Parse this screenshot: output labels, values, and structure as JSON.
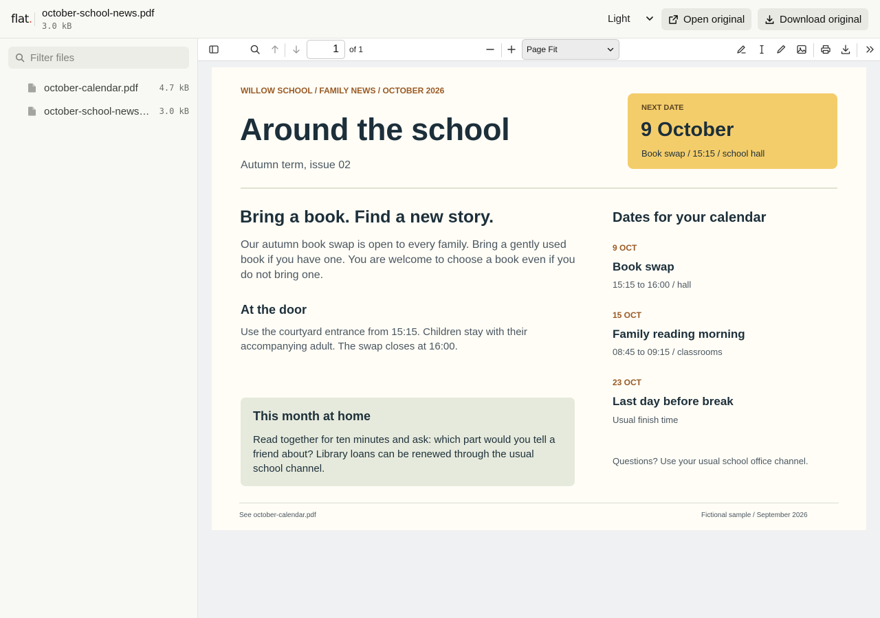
{
  "app": {
    "brand": "flat",
    "brand_dot": "."
  },
  "document": {
    "name": "october-school-news.pdf",
    "size": "3.0 kB"
  },
  "header": {
    "theme_value": "Light",
    "open_label": "Open original",
    "download_label": "Download original"
  },
  "sidebar": {
    "filter_placeholder": "Filter files",
    "files": [
      {
        "name": "october-calendar.pdf",
        "size": "4.7 kB"
      },
      {
        "name": "october-school-news.pdf",
        "size": "3.0 kB"
      }
    ]
  },
  "viewer": {
    "page_number": "1",
    "page_of": "of 1",
    "zoom_value": "Page Fit"
  },
  "page": {
    "kicker": "WILLOW SCHOOL / FAMILY NEWS / OCTOBER 2026",
    "title": "Around the school",
    "subtitle": "Autumn term, issue 02",
    "next": {
      "label": "NEXT DATE",
      "date": "9 October",
      "detail": "Book swap / 15:15 / school hall"
    },
    "main_heading": "Bring a book. Find a new story.",
    "lead": "Our autumn book swap is open to every family. Bring a gently used book if you have one. You are welcome to choose a book even if you do not bring one.",
    "door_heading": "At the door",
    "door_text": "Use the courtyard entrance from 15:15. Children stay with their accompanying adult. The swap closes at 16:00.",
    "home": {
      "heading": "This month at home",
      "text": "Read together for ten minutes and ask: which part would you tell a friend about? Library loans can be renewed through the usual school channel."
    },
    "calendar_heading": "Dates for your calendar",
    "events": [
      {
        "date": "9 OCT",
        "title": "Book swap",
        "detail": "15:15 to 16:00 / hall"
      },
      {
        "date": "15 OCT",
        "title": "Family reading morning",
        "detail": "08:45 to 09:15 / classrooms"
      },
      {
        "date": "23 OCT",
        "title": "Last day before break",
        "detail": "Usual finish time"
      }
    ],
    "questions": "Questions? Use your usual school office channel.",
    "footer_left": "See october-calendar.pdf",
    "footer_right": "Fictional sample / September 2026"
  },
  "icons": {
    "file": "file-icon",
    "search": "search-icon",
    "sidebar_toggle": "sidebar-toggle-icon",
    "external": "external-link-icon",
    "download": "download-icon"
  },
  "colors": {
    "accent_kicker": "#9a5a24",
    "next_box": "#f4cd6b",
    "home_box": "#e6eadc",
    "ink": "#1c2f3a"
  }
}
